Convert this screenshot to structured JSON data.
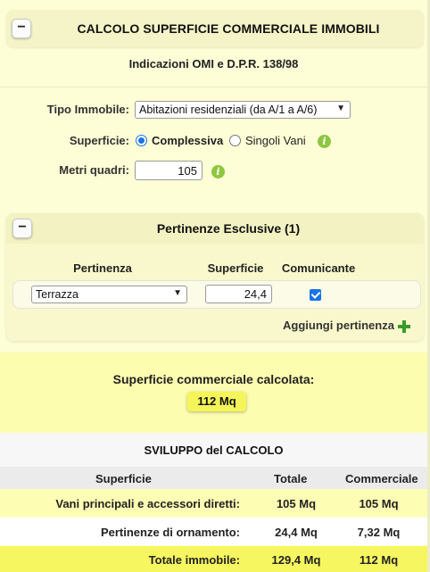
{
  "header": {
    "title": "CALCOLO SUPERFICIE COMMERCIALE IMMOBILI",
    "collapse": "−"
  },
  "subtitle": "Indicazioni OMI e D.P.R. 138/98",
  "form": {
    "tipo_label": "Tipo Immobile:",
    "tipo_value": "Abitazioni residenziali (da A/1 a A/6)",
    "superficie_label": "Superficie:",
    "superficie_options": [
      "Complessiva",
      "Singoli Vani"
    ],
    "superficie_selected": "Complessiva",
    "metri_label": "Metri quadri:",
    "metri_value": "105",
    "info_glyph": "i"
  },
  "pertinenze": {
    "title": "Pertinenze Esclusive (1)",
    "collapse": "−",
    "columns": [
      "Pertinenza",
      "Superficie",
      "Comunicante"
    ],
    "rows": [
      {
        "pertinenza": "Terrazza",
        "superficie": "24,4",
        "comunicante": true
      }
    ],
    "add_label": "Aggiungi pertinenza"
  },
  "result": {
    "title": "Superficie commerciale calcolata:",
    "value": "112 Mq"
  },
  "sviluppo": {
    "title": "SVILUPPO del CALCOLO",
    "columns": [
      "Superficie",
      "Totale",
      "Commerciale"
    ],
    "rows": [
      {
        "label": "Vani principali e accessori diretti:",
        "totale": "105 Mq",
        "commerciale": "105 Mq"
      },
      {
        "label": "Pertinenze di ornamento:",
        "totale": "24,4 Mq",
        "commerciale": "7,32 Mq"
      },
      {
        "label": "Totale immobile:",
        "totale": "129,4 Mq",
        "commerciale": "112 Mq"
      }
    ]
  },
  "colors": {
    "panel": "#fdfdd6",
    "highlight": "#f5f55a",
    "radio_blue": "#1a73e8",
    "info_green": "#8dc63f",
    "plus_green": "#3a9b2a"
  },
  "icons": {
    "collapse": "minus-icon",
    "info": "info-icon",
    "add": "plus-icon",
    "select": "chevron-down-icon"
  }
}
